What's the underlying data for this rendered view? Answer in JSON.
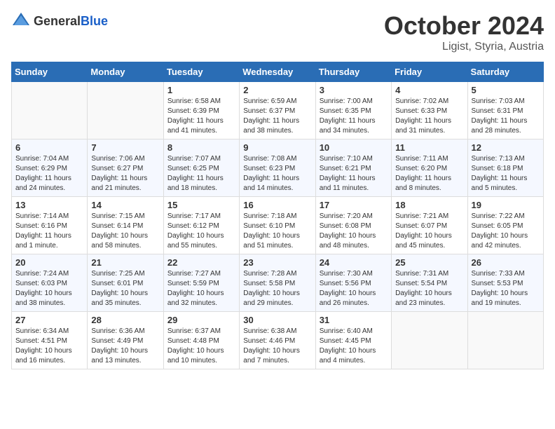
{
  "header": {
    "logo_general": "General",
    "logo_blue": "Blue",
    "month_title": "October 2024",
    "location": "Ligist, Styria, Austria"
  },
  "calendar": {
    "days_of_week": [
      "Sunday",
      "Monday",
      "Tuesday",
      "Wednesday",
      "Thursday",
      "Friday",
      "Saturday"
    ],
    "weeks": [
      [
        {
          "day": "",
          "content": ""
        },
        {
          "day": "",
          "content": ""
        },
        {
          "day": "1",
          "content": "Sunrise: 6:58 AM\nSunset: 6:39 PM\nDaylight: 11 hours and 41 minutes."
        },
        {
          "day": "2",
          "content": "Sunrise: 6:59 AM\nSunset: 6:37 PM\nDaylight: 11 hours and 38 minutes."
        },
        {
          "day": "3",
          "content": "Sunrise: 7:00 AM\nSunset: 6:35 PM\nDaylight: 11 hours and 34 minutes."
        },
        {
          "day": "4",
          "content": "Sunrise: 7:02 AM\nSunset: 6:33 PM\nDaylight: 11 hours and 31 minutes."
        },
        {
          "day": "5",
          "content": "Sunrise: 7:03 AM\nSunset: 6:31 PM\nDaylight: 11 hours and 28 minutes."
        }
      ],
      [
        {
          "day": "6",
          "content": "Sunrise: 7:04 AM\nSunset: 6:29 PM\nDaylight: 11 hours and 24 minutes."
        },
        {
          "day": "7",
          "content": "Sunrise: 7:06 AM\nSunset: 6:27 PM\nDaylight: 11 hours and 21 minutes."
        },
        {
          "day": "8",
          "content": "Sunrise: 7:07 AM\nSunset: 6:25 PM\nDaylight: 11 hours and 18 minutes."
        },
        {
          "day": "9",
          "content": "Sunrise: 7:08 AM\nSunset: 6:23 PM\nDaylight: 11 hours and 14 minutes."
        },
        {
          "day": "10",
          "content": "Sunrise: 7:10 AM\nSunset: 6:21 PM\nDaylight: 11 hours and 11 minutes."
        },
        {
          "day": "11",
          "content": "Sunrise: 7:11 AM\nSunset: 6:20 PM\nDaylight: 11 hours and 8 minutes."
        },
        {
          "day": "12",
          "content": "Sunrise: 7:13 AM\nSunset: 6:18 PM\nDaylight: 11 hours and 5 minutes."
        }
      ],
      [
        {
          "day": "13",
          "content": "Sunrise: 7:14 AM\nSunset: 6:16 PM\nDaylight: 11 hours and 1 minute."
        },
        {
          "day": "14",
          "content": "Sunrise: 7:15 AM\nSunset: 6:14 PM\nDaylight: 10 hours and 58 minutes."
        },
        {
          "day": "15",
          "content": "Sunrise: 7:17 AM\nSunset: 6:12 PM\nDaylight: 10 hours and 55 minutes."
        },
        {
          "day": "16",
          "content": "Sunrise: 7:18 AM\nSunset: 6:10 PM\nDaylight: 10 hours and 51 minutes."
        },
        {
          "day": "17",
          "content": "Sunrise: 7:20 AM\nSunset: 6:08 PM\nDaylight: 10 hours and 48 minutes."
        },
        {
          "day": "18",
          "content": "Sunrise: 7:21 AM\nSunset: 6:07 PM\nDaylight: 10 hours and 45 minutes."
        },
        {
          "day": "19",
          "content": "Sunrise: 7:22 AM\nSunset: 6:05 PM\nDaylight: 10 hours and 42 minutes."
        }
      ],
      [
        {
          "day": "20",
          "content": "Sunrise: 7:24 AM\nSunset: 6:03 PM\nDaylight: 10 hours and 38 minutes."
        },
        {
          "day": "21",
          "content": "Sunrise: 7:25 AM\nSunset: 6:01 PM\nDaylight: 10 hours and 35 minutes."
        },
        {
          "day": "22",
          "content": "Sunrise: 7:27 AM\nSunset: 5:59 PM\nDaylight: 10 hours and 32 minutes."
        },
        {
          "day": "23",
          "content": "Sunrise: 7:28 AM\nSunset: 5:58 PM\nDaylight: 10 hours and 29 minutes."
        },
        {
          "day": "24",
          "content": "Sunrise: 7:30 AM\nSunset: 5:56 PM\nDaylight: 10 hours and 26 minutes."
        },
        {
          "day": "25",
          "content": "Sunrise: 7:31 AM\nSunset: 5:54 PM\nDaylight: 10 hours and 23 minutes."
        },
        {
          "day": "26",
          "content": "Sunrise: 7:33 AM\nSunset: 5:53 PM\nDaylight: 10 hours and 19 minutes."
        }
      ],
      [
        {
          "day": "27",
          "content": "Sunrise: 6:34 AM\nSunset: 4:51 PM\nDaylight: 10 hours and 16 minutes."
        },
        {
          "day": "28",
          "content": "Sunrise: 6:36 AM\nSunset: 4:49 PM\nDaylight: 10 hours and 13 minutes."
        },
        {
          "day": "29",
          "content": "Sunrise: 6:37 AM\nSunset: 4:48 PM\nDaylight: 10 hours and 10 minutes."
        },
        {
          "day": "30",
          "content": "Sunrise: 6:38 AM\nSunset: 4:46 PM\nDaylight: 10 hours and 7 minutes."
        },
        {
          "day": "31",
          "content": "Sunrise: 6:40 AM\nSunset: 4:45 PM\nDaylight: 10 hours and 4 minutes."
        },
        {
          "day": "",
          "content": ""
        },
        {
          "day": "",
          "content": ""
        }
      ]
    ]
  }
}
